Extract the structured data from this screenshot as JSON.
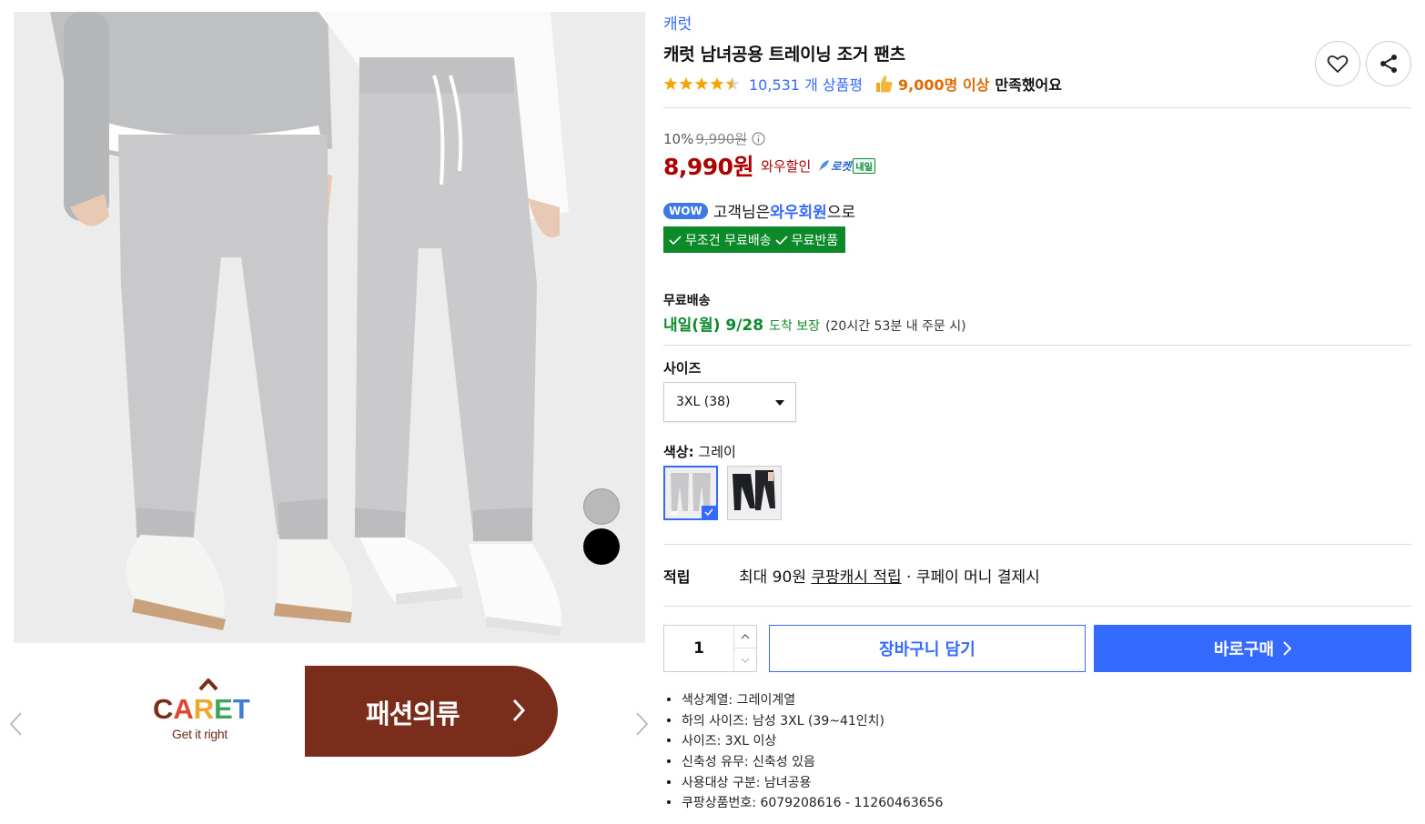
{
  "product": {
    "brand": "캐럿",
    "title": "캐럿 남녀공용 트레이닝 조거 팬츠",
    "rating": 4.5,
    "review_count": "10,531 개 상품평",
    "satisfied_count": "9,000명 이상",
    "satisfied_text": "만족했어요"
  },
  "icons": {
    "like": "heart-icon",
    "share": "share-icon",
    "thumb": "thumbs-up-icon",
    "info": "info-icon",
    "rocket": "rocket-icon"
  },
  "price": {
    "discount": "10%",
    "original": "9,990원",
    "final": "8,990원",
    "sale_label": "와우할인",
    "rocket_label": "로켓",
    "delivery_badge": "내일"
  },
  "wow": {
    "badge": "WOW",
    "prefix": "고객님은 ",
    "member": "와우회원",
    "suffix": "으로",
    "benefit_1": "무조건 무료배송",
    "benefit_2": "무료반품"
  },
  "shipping": {
    "label": "무료배송",
    "date": "내일(월) 9/28",
    "guarantee": "도착 보장",
    "cutoff": "(20시간 53분 내 주문 시)"
  },
  "size": {
    "label": "사이즈",
    "selected": "3XL (38)"
  },
  "color": {
    "label": "색상:",
    "selected": "그레이",
    "options": [
      "그레이",
      "블랙"
    ]
  },
  "points": {
    "label": "적립",
    "prefix": "최대 90원 ",
    "cash": "쿠팡캐시 적립",
    "suffix": " · 쿠페이 머니 결제시"
  },
  "purchase": {
    "quantity": "1",
    "cart_label": "장바구니 담기",
    "buy_label": "바로구매"
  },
  "specs": [
    "색상계열: 그레이계열",
    "하의 사이즈: 남성 3XL (39~41인치)",
    "사이즈: 3XL 이상",
    "신축성 유무: 신축성 있음",
    "사용대상 구분: 남녀공용",
    "쿠팡상품번호: 6079208616 - 11260463656"
  ],
  "banner": {
    "logo_text": "CARET",
    "logo_tagline": "Get it right",
    "category": "패션의류"
  },
  "colors": {
    "accent_blue": "#346aff",
    "price_red": "#ae0000",
    "delivery_green": "#0c8a2a",
    "banner_brown": "#7b2d1c"
  }
}
